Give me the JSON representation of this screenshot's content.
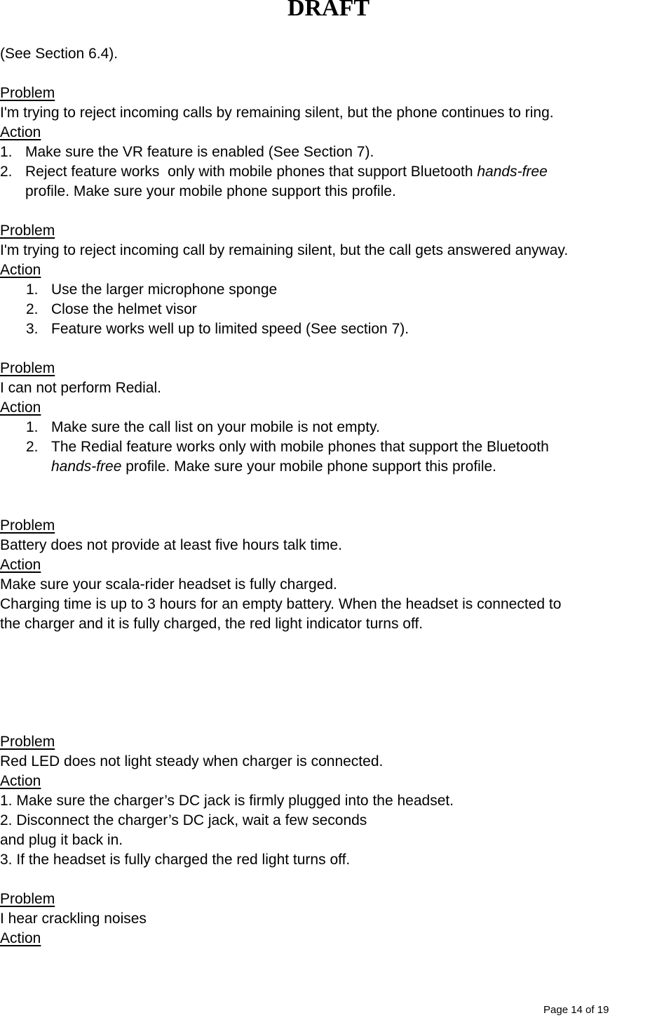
{
  "header": {
    "title": "DRAFT"
  },
  "intro": "(See Section 6.4).",
  "labels": {
    "problem": "Problem",
    "action": "Action"
  },
  "sections": [
    {
      "problem": "I'm trying to reject incoming calls by remaining silent, but the phone continues to ring.",
      "actions": [
        {
          "num": "1.",
          "text": "Make sure the VR feature is enabled (See Section 7)."
        },
        {
          "num": "2.",
          "text_a": "Reject feature works  only with mobile phones that support Bluetooth ",
          "italic": "hands-free",
          "text_b": "profile. Make sure your mobile phone support this profile."
        }
      ]
    },
    {
      "problem": "I'm trying to reject incoming call by remaining silent, but the call gets answered anyway.",
      "actions": [
        {
          "num": "1.",
          "text": "Use the larger microphone sponge"
        },
        {
          "num": "2.",
          "text": "Close the helmet visor"
        },
        {
          "num": "3.",
          "text": "Feature works well up to limited speed (See section 7)."
        }
      ]
    },
    {
      "problem": "I can not perform Redial.",
      "actions": [
        {
          "num": "1.",
          "text": "Make sure the call list on your mobile is not empty."
        },
        {
          "num": "2.",
          "text_a": "The Redial feature works only with mobile phones that support the Bluetooth",
          "italic": "hands-free",
          "text_b": " profile. Make sure your mobile phone support this profile."
        }
      ]
    },
    {
      "problem": "Battery does not provide at least five hours talk time.",
      "actions": [
        {
          "text": "Make sure your scala-rider headset is fully charged."
        },
        {
          "text": "Charging time is up to 3 hours for an empty battery. When the headset is connected to"
        },
        {
          "text": "the charger and it is fully charged, the red light indicator turns off."
        }
      ]
    },
    {
      "problem": "Red LED does not light steady when charger is connected.",
      "actions": [
        {
          "text": "1. Make sure the charger’s DC jack is firmly plugged into the headset."
        },
        {
          "text": "2. Disconnect the charger’s DC jack, wait a few seconds"
        },
        {
          "text": "and plug it back in."
        },
        {
          "text": "3. If the headset is fully charged the red light turns off."
        }
      ]
    },
    {
      "problem": "I hear crackling noises",
      "actions": []
    }
  ],
  "footer": {
    "page": "Page 14 of 19"
  }
}
